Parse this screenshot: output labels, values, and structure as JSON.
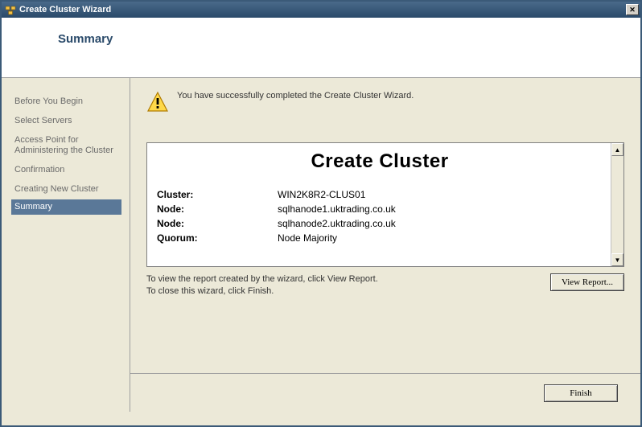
{
  "window": {
    "title": "Create Cluster Wizard"
  },
  "header": {
    "page_title": "Summary"
  },
  "sidebar": {
    "items": [
      {
        "label": "Before You Begin",
        "active": false
      },
      {
        "label": "Select Servers",
        "active": false
      },
      {
        "label": "Access Point for Administering the Cluster",
        "active": false
      },
      {
        "label": "Confirmation",
        "active": false
      },
      {
        "label": "Creating New Cluster",
        "active": false
      },
      {
        "label": "Summary",
        "active": true
      }
    ]
  },
  "main": {
    "success_message": "You have successfully completed the Create Cluster Wizard.",
    "report": {
      "title": "Create Cluster",
      "rows": [
        {
          "key": "Cluster:",
          "value": "WIN2K8R2-CLUS01"
        },
        {
          "key": "Node:",
          "value": "sqlhanode1.uktrading.co.uk"
        },
        {
          "key": "Node:",
          "value": "sqlhanode2.uktrading.co.uk"
        },
        {
          "key": "Quorum:",
          "value": "Node Majority"
        }
      ]
    },
    "hint_line1": "To view the report created by the wizard, click View Report.",
    "hint_line2": "To close this wizard, click Finish.",
    "view_report_button": "View Report...",
    "finish_button": "Finish"
  }
}
